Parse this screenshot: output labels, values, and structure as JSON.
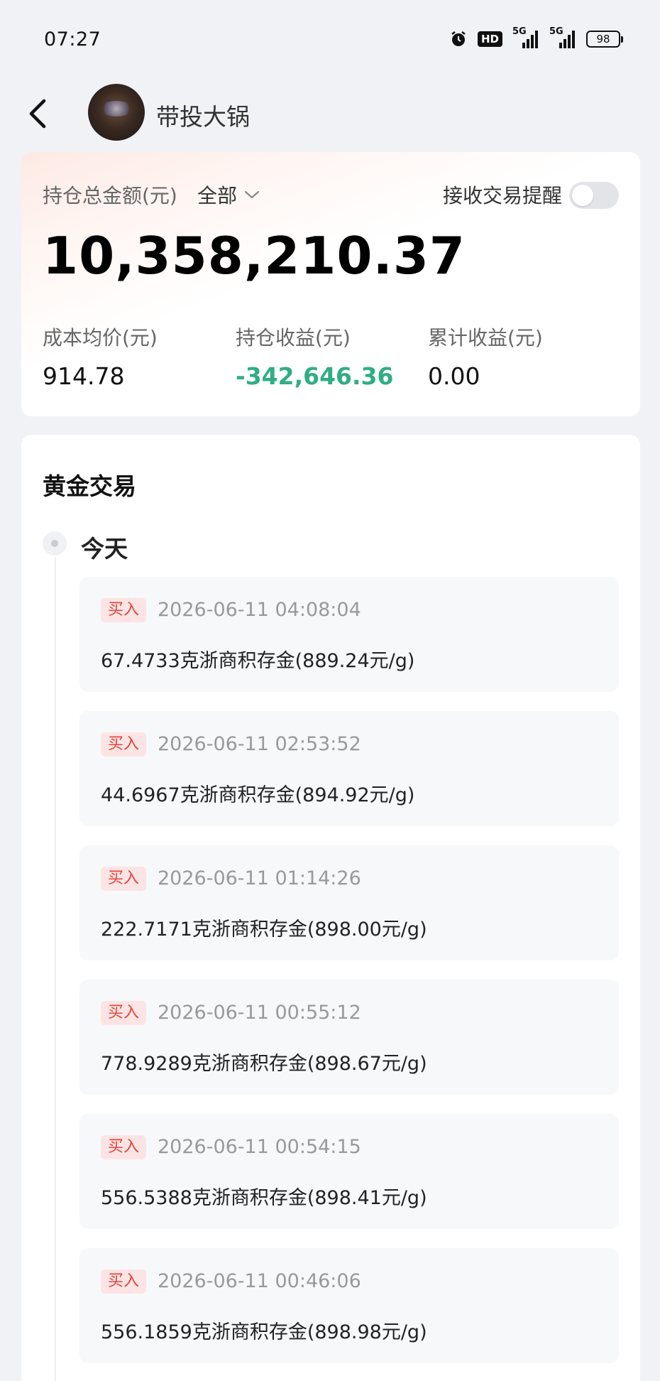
{
  "status_bar": {
    "time": "07:27",
    "icons": [
      "alarm-icon",
      "hd-icon",
      "signal-5g-icon",
      "signal-5g-icon",
      "battery-icon"
    ],
    "hd_label": "HD",
    "network_label": "5G",
    "battery_level": "98"
  },
  "header": {
    "title": "带投大锅",
    "back_icon": "chevron-left-icon"
  },
  "summary": {
    "total_label": "持仓总金额(元)",
    "filter_label": "全部",
    "remind_label": "接收交易提醒",
    "remind_enabled": false,
    "total_value": "10,358,210.37",
    "cost_label": "成本均价(元)",
    "cost_value": "914.78",
    "profit_label": "持仓收益(元)",
    "profit_value": "-342,646.36",
    "profit_color": "#2fae83",
    "cumulative_label": "累计收益(元)",
    "cumulative_value": "0.00"
  },
  "trades": {
    "title": "黄金交易",
    "group_label": "今天",
    "items": [
      {
        "type": "买入",
        "time": "2026-06-11 04:08:04",
        "desc": "67.4733克浙商积存金(889.24元/g)"
      },
      {
        "type": "买入",
        "time": "2026-06-11 02:53:52",
        "desc": "44.6967克浙商积存金(894.92元/g)"
      },
      {
        "type": "买入",
        "time": "2026-06-11 01:14:26",
        "desc": "222.7171克浙商积存金(898.00元/g)"
      },
      {
        "type": "买入",
        "time": "2026-06-11 00:55:12",
        "desc": "778.9289克浙商积存金(898.67元/g)"
      },
      {
        "type": "买入",
        "time": "2026-06-11 00:54:15",
        "desc": "556.5388克浙商积存金(898.41元/g)"
      },
      {
        "type": "买入",
        "time": "2026-06-11 00:46:06",
        "desc": "556.1859克浙商积存金(898.98元/g)"
      }
    ],
    "buy_color": "#e0443a"
  }
}
